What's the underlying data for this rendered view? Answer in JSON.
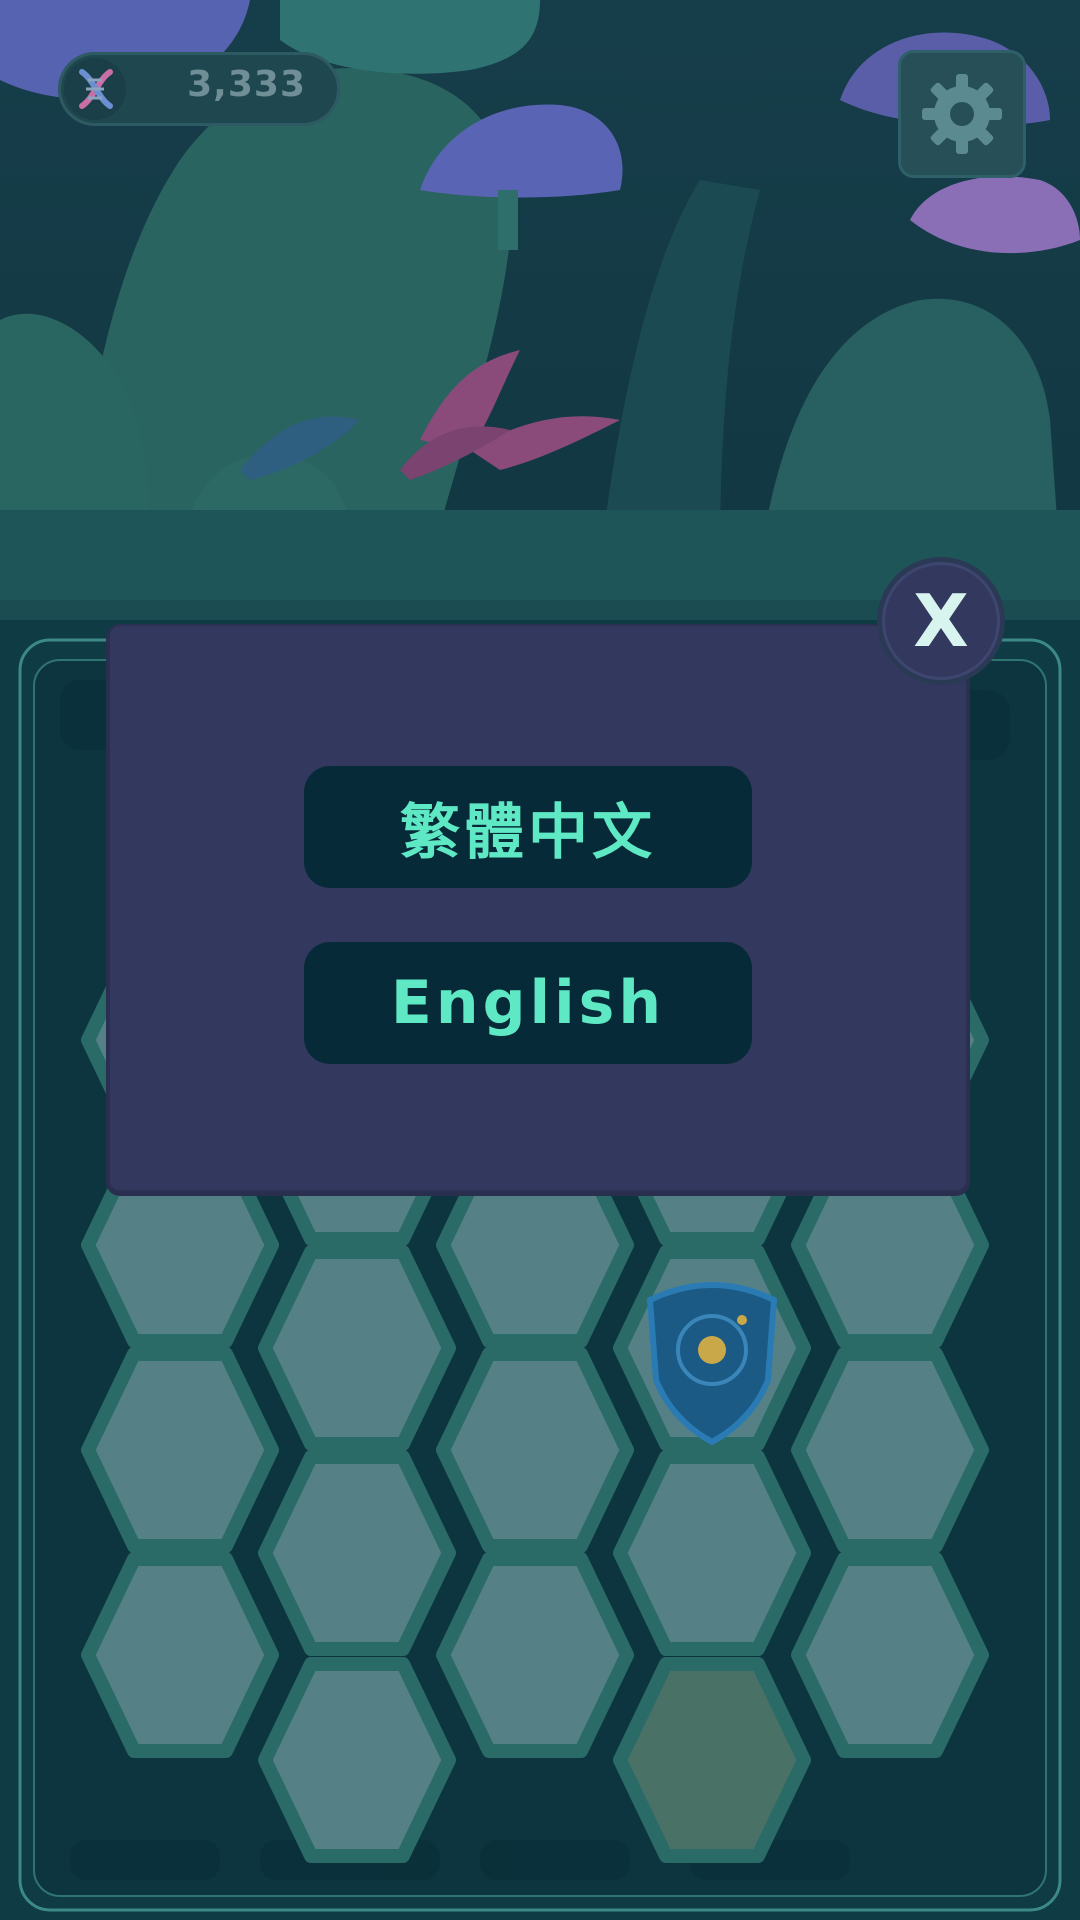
{
  "hud": {
    "currency_icon": "dna-icon",
    "currency_amount": "3,333",
    "settings_icon": "gear-icon"
  },
  "language_dialog": {
    "close_label": "X",
    "options": [
      {
        "label": "繁體中文"
      },
      {
        "label": "English"
      }
    ]
  },
  "board": {
    "shield_icon": "shield-icon"
  },
  "colors": {
    "dialog_bg": "#33385e",
    "button_bg": "#062a38",
    "button_text": "#5fe8c4",
    "hex_tile": "#558086",
    "hex_tile_highlight": "#4a7166"
  }
}
